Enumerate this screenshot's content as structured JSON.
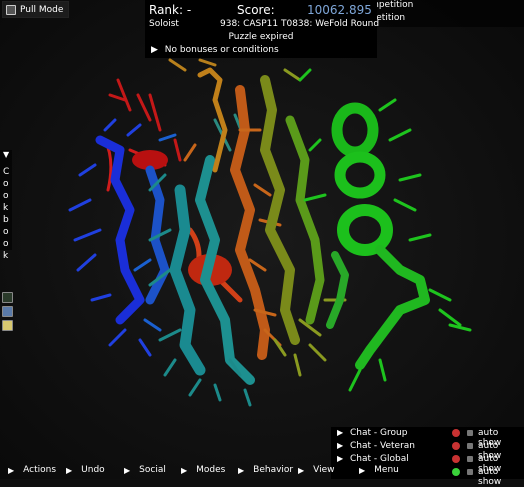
{
  "pull_mode": {
    "label": "Pull Mode",
    "icon": "pull-mode-icon"
  },
  "score_panel": {
    "rank_label": "Rank: -",
    "score_label": "Score:",
    "score_value": "10062.895",
    "player_mode": "Soloist",
    "puzzle_name": "938: CASP11 T0838: WeFold Round",
    "puzzle_status": "Puzzle expired",
    "bonus_text": "No bonuses or conditions",
    "score_color": "#7ea6d8"
  },
  "competitions": {
    "line1": "up Competition",
    "line2": "Competition"
  },
  "cookbook": {
    "label": "C\no\no\nk\nb\no\no\nk"
  },
  "side_icons": [
    "console-icon",
    "folder-icon",
    "notes-icon"
  ],
  "chat": [
    {
      "label": "Chat - Group",
      "status_color": "#c83232",
      "auto_label": "auto show"
    },
    {
      "label": "Chat - Veteran",
      "status_color": "#c83232",
      "auto_label": "auto show"
    },
    {
      "label": "Chat - Global",
      "status_color": "#c83232",
      "auto_label": "auto show"
    },
    {
      "label": "",
      "status_color": "#3ad23a",
      "auto_label": "auto show"
    }
  ],
  "bottom_bar": [
    {
      "label": "Actions"
    },
    {
      "label": "Undo"
    },
    {
      "label": "Social"
    },
    {
      "label": "Modes"
    },
    {
      "label": "Behavior"
    },
    {
      "label": "View"
    },
    {
      "label": "Menu"
    }
  ]
}
